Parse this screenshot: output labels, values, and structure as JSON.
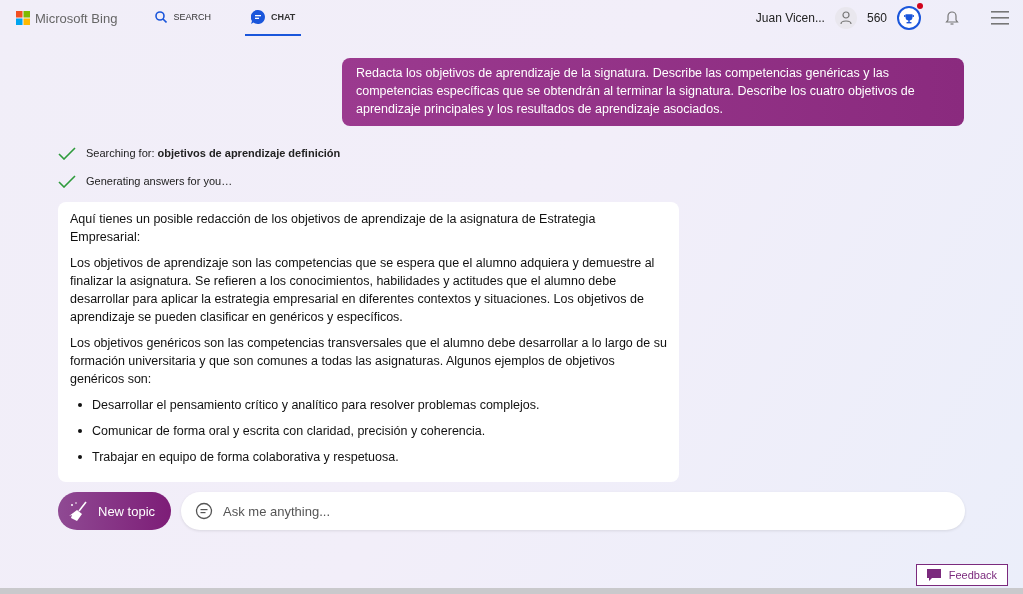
{
  "header": {
    "logo": "Microsoft Bing",
    "tabs": [
      {
        "label": "SEARCH",
        "kind": "search",
        "selected": false
      },
      {
        "label": "CHAT",
        "kind": "chat",
        "selected": true
      }
    ],
    "user_name": "Juan Vicen...",
    "points": "560",
    "rewards_notification": true
  },
  "user_message": "Redacta los objetivos de aprendizaje de la signatura. Describe las competencias genéricas y las competencias específicas que se obtendrán al terminar la signatura. Describe los cuatro objetivos de aprendizaje principales y los resultados de aprendizaje asociados.",
  "progress": [
    {
      "text": "Searching for: **objetivos de aprendizaje definición**",
      "done": true
    },
    {
      "text": "Generating answers for you…",
      "done": true
    }
  ],
  "answer": [
    {
      "kind": "paragraph",
      "text": "Aquí tienes un posible redacción de los objetivos de aprendizaje de la asignatura de Estrategia Empresarial:"
    },
    {
      "kind": "paragraph",
      "text": "Los objetivos de aprendizaje son las competencias que se espera que el alumno adquiera y demuestre al finalizar la asignatura. Se refieren a los conocimientos, habilidades y actitudes que el alumno debe desarrollar para aplicar la estrategia empresarial en diferentes contextos y situaciones. Los objetivos de aprendizaje se pueden clasificar en genéricos y específicos."
    },
    {
      "kind": "paragraph",
      "text": "Los objetivos genéricos son las competencias transversales que el alumno debe desarrollar a lo largo de su formación universitaria y que son comunes a todas las asignaturas. Algunos ejemplos de objetivos genéricos son:"
    },
    {
      "kind": "bullet",
      "text": "Desarrollar el pensamiento crítico y analítico para resolver problemas complejos."
    },
    {
      "kind": "bullet",
      "text": "Comunicar de forma oral y escrita con claridad, precisión y coherencia."
    },
    {
      "kind": "bullet",
      "text": "Trabajar en equipo de forma colaborativa y respetuosa."
    }
  ],
  "new_topic": "New topic",
  "input": {
    "placeholder": "Ask me anything..."
  },
  "feedback": "Feedback"
}
